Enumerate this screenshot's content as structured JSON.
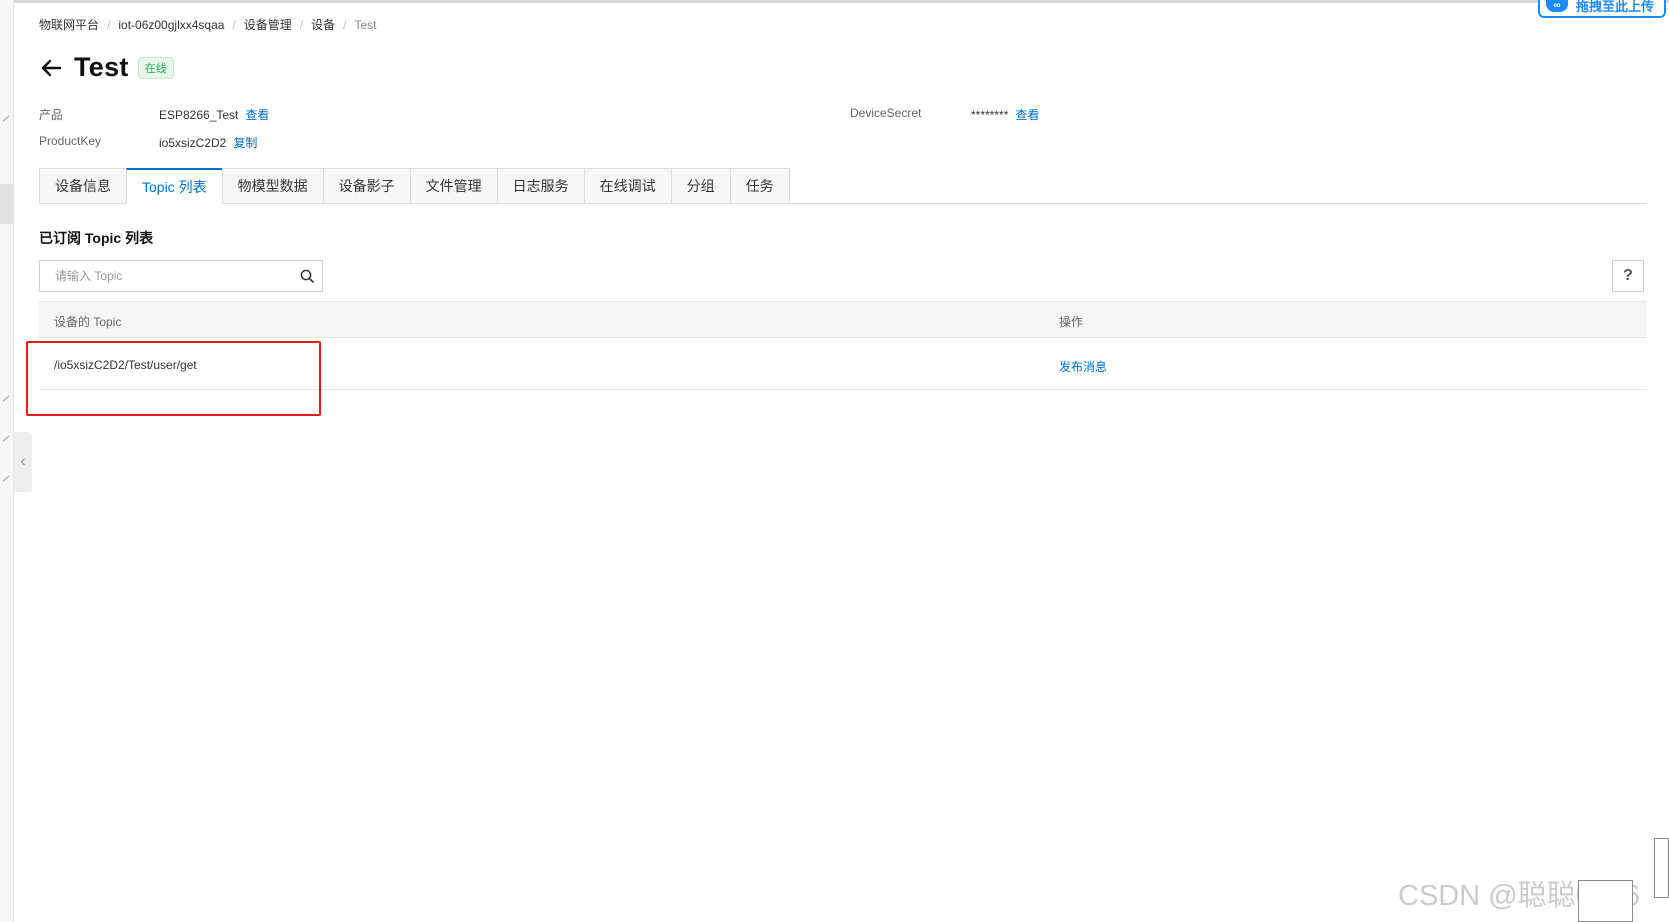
{
  "breadcrumb": {
    "items": [
      "物联网平台",
      "iot-06z00gjlxx4sqaa",
      "设备管理",
      "设备",
      "Test"
    ],
    "separator": "/"
  },
  "floating_button": {
    "label": "拖拽至此上传",
    "icon": "cloud-upload-icon"
  },
  "header": {
    "title": "Test",
    "status": "在线",
    "back_icon": "arrow-left-icon"
  },
  "device_info": {
    "product_label": "产品",
    "product_value": "ESP8266_Test",
    "product_link": "查看",
    "productkey_label": "ProductKey",
    "productkey_value": "io5xsizC2D2",
    "productkey_link": "复制",
    "secret_label": "DeviceSecret",
    "secret_value": "********",
    "secret_link": "查看"
  },
  "tabs": [
    {
      "label": "设备信息",
      "active": false
    },
    {
      "label": "Topic 列表",
      "active": true
    },
    {
      "label": "物模型数据",
      "active": false
    },
    {
      "label": "设备影子",
      "active": false
    },
    {
      "label": "文件管理",
      "active": false
    },
    {
      "label": "日志服务",
      "active": false
    },
    {
      "label": "在线调试",
      "active": false
    },
    {
      "label": "分组",
      "active": false
    },
    {
      "label": "任务",
      "active": false
    }
  ],
  "section": {
    "title": "已订阅 Topic 列表"
  },
  "search": {
    "placeholder": "请输入 Topic",
    "value": ""
  },
  "help": {
    "label": "?"
  },
  "table": {
    "columns": [
      "设备的 Topic",
      "操作"
    ],
    "rows": [
      {
        "topic": "/io5xsizC2D2/Test/user/get",
        "action": "发布消息"
      }
    ]
  },
  "watermark": "CSDN @聪聪0606",
  "colors": {
    "link": "#0070cc",
    "status_green": "#2fa84f",
    "highlight_red": "#e0201b"
  }
}
